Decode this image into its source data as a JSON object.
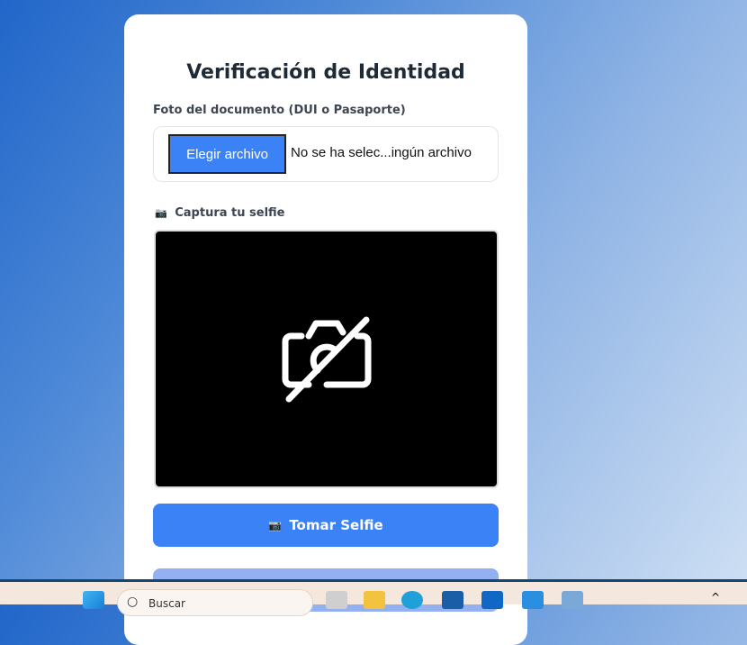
{
  "form": {
    "title": "Verificación de Identidad",
    "document_label": "Foto del documento (DUI o Pasaporte)",
    "file_button": "Elegir archivo",
    "file_status": "No se ha selec...ingún archivo",
    "selfie_icon": "📷",
    "selfie_label": "Captura tu selfie",
    "camera_state_icon": "camera-off-icon",
    "take_selfie_icon": "📷",
    "take_selfie_label": "Tomar Selfie",
    "accent": "#3b82f6",
    "disabled_button_color": "#93b0f0"
  },
  "taskbar": {
    "search_placeholder": "Buscar",
    "icons": [
      "windows-start-icon",
      "search-icon",
      "task-view-icon",
      "file-explorer-icon",
      "edge-icon",
      "store-icon",
      "outlook-icon",
      "vscode-icon",
      "app-icon",
      "chevron-up-icon"
    ]
  }
}
